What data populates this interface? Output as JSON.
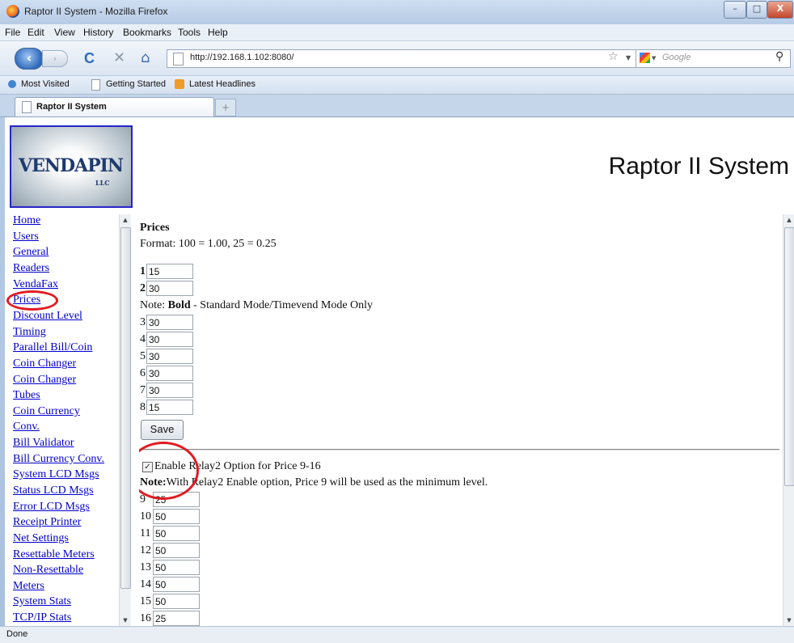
{
  "window": {
    "title": "Raptor II System - Mozilla Firefox",
    "controls": {
      "minimize": "–",
      "maximize": "□",
      "close": "X"
    }
  },
  "menubar": {
    "items": [
      "File",
      "Edit",
      "View",
      "History",
      "Bookmarks",
      "Tools",
      "Help"
    ]
  },
  "navbar": {
    "back": "‹",
    "forward": "›",
    "reload": "C",
    "stop": "✕",
    "home": "⌂",
    "url": "http://192.168.1.102:8080/",
    "star": "☆",
    "search_placeholder": "Google",
    "search_icon": "⚲"
  },
  "bookmarks": {
    "items": [
      "Most Visited",
      "Getting Started",
      "Latest Headlines"
    ]
  },
  "tabs": {
    "active": "Raptor II System",
    "new_tab": "+"
  },
  "header": {
    "logo_text": "VENDAPIN",
    "logo_llc": "LLC",
    "page_title": "Raptor II System"
  },
  "sidebar": {
    "items": [
      "Home",
      "Users",
      "General",
      "Readers",
      "VendaFax",
      "Prices",
      "Discount Level",
      "Timing",
      "Parallel Bill/Coin",
      "Coin Changer",
      "Coin Changer",
      "Tubes",
      "Coin Currency",
      "Conv.",
      "Bill Validator",
      "Bill Currency Conv.",
      "System LCD Msgs",
      "Status LCD Msgs",
      "Error LCD Msgs",
      "Receipt Printer",
      "Net Settings",
      "Resettable Meters",
      "Non-Resettable",
      "Meters",
      "System Stats",
      "TCP/IP Stats"
    ]
  },
  "main": {
    "heading": "Prices",
    "format": "Format: 100 = 1.00, 25 = 0.25",
    "note_prefix": "Note: ",
    "note_bold": "Bold",
    "note_rest": " - Standard Mode/Timevend Mode Only",
    "prices_top": [
      {
        "label": "1",
        "value": "15",
        "bold": true
      },
      {
        "label": "2",
        "value": "30",
        "bold": true
      },
      {
        "label": "3",
        "value": "30",
        "bold": false
      },
      {
        "label": "4",
        "value": "30",
        "bold": false
      },
      {
        "label": "5",
        "value": "30",
        "bold": false
      },
      {
        "label": "6",
        "value": "30",
        "bold": false
      },
      {
        "label": "7",
        "value": "30",
        "bold": false
      },
      {
        "label": "8",
        "value": "15",
        "bold": false
      }
    ],
    "save": "Save",
    "relay_checkbox": "✓",
    "relay_label": "Enable Relay2 Option for Price 9-16",
    "relay_note_bold": "Note:",
    "relay_note": "With Relay2 Enable option, Price 9 will be used as the minimum level.",
    "prices_bottom": [
      {
        "label": "9",
        "value": "25"
      },
      {
        "label": "10",
        "value": "50"
      },
      {
        "label": "11",
        "value": "50"
      },
      {
        "label": "12",
        "value": "50"
      },
      {
        "label": "13",
        "value": "50"
      },
      {
        "label": "14",
        "value": "50"
      },
      {
        "label": "15",
        "value": "50"
      },
      {
        "label": "16",
        "value": "25"
      }
    ]
  },
  "status": {
    "text": "Done"
  }
}
